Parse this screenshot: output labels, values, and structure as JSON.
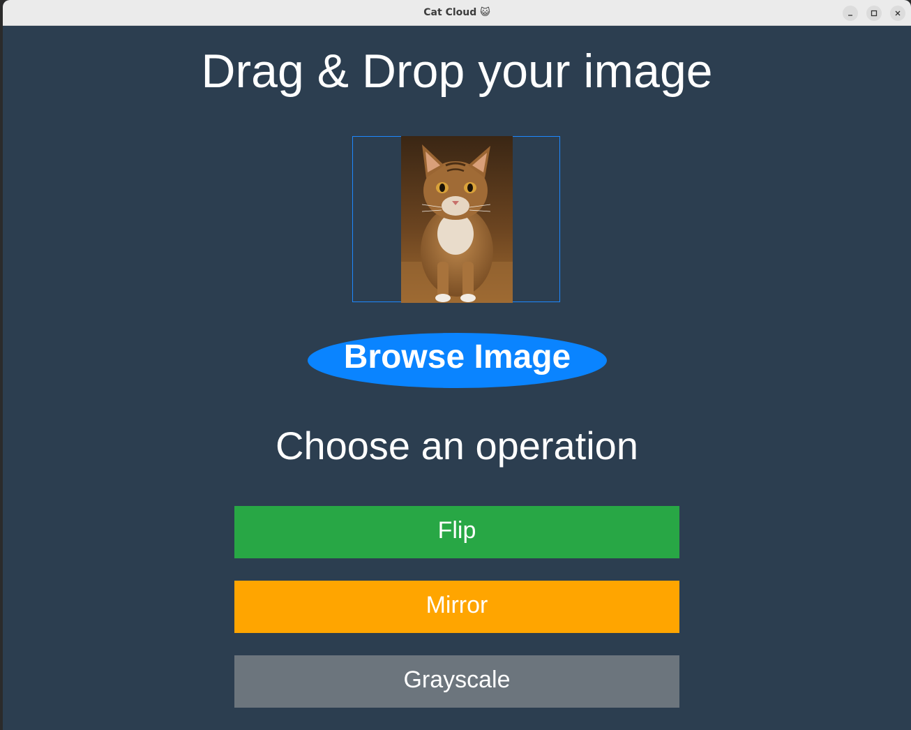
{
  "window": {
    "title": "Cat Cloud 😺",
    "controls": {
      "minimize_icon": "minimize-icon",
      "maximize_icon": "maximize-icon",
      "close_icon": "close-icon"
    }
  },
  "main": {
    "heading": "Drag & Drop your image",
    "drop_zone": {
      "preview_image": "cat photo",
      "border_color": "#1e88ff"
    },
    "browse_button": {
      "label": "Browse Image",
      "color": "#0a84ff"
    },
    "operations_heading": "Choose an operation",
    "operations": [
      {
        "label": "Flip",
        "color": "#28a745"
      },
      {
        "label": "Mirror",
        "color": "#ffa500"
      },
      {
        "label": "Grayscale",
        "color": "#6c757d"
      }
    ]
  },
  "colors": {
    "background": "#2c3e50",
    "text": "#ffffff"
  }
}
